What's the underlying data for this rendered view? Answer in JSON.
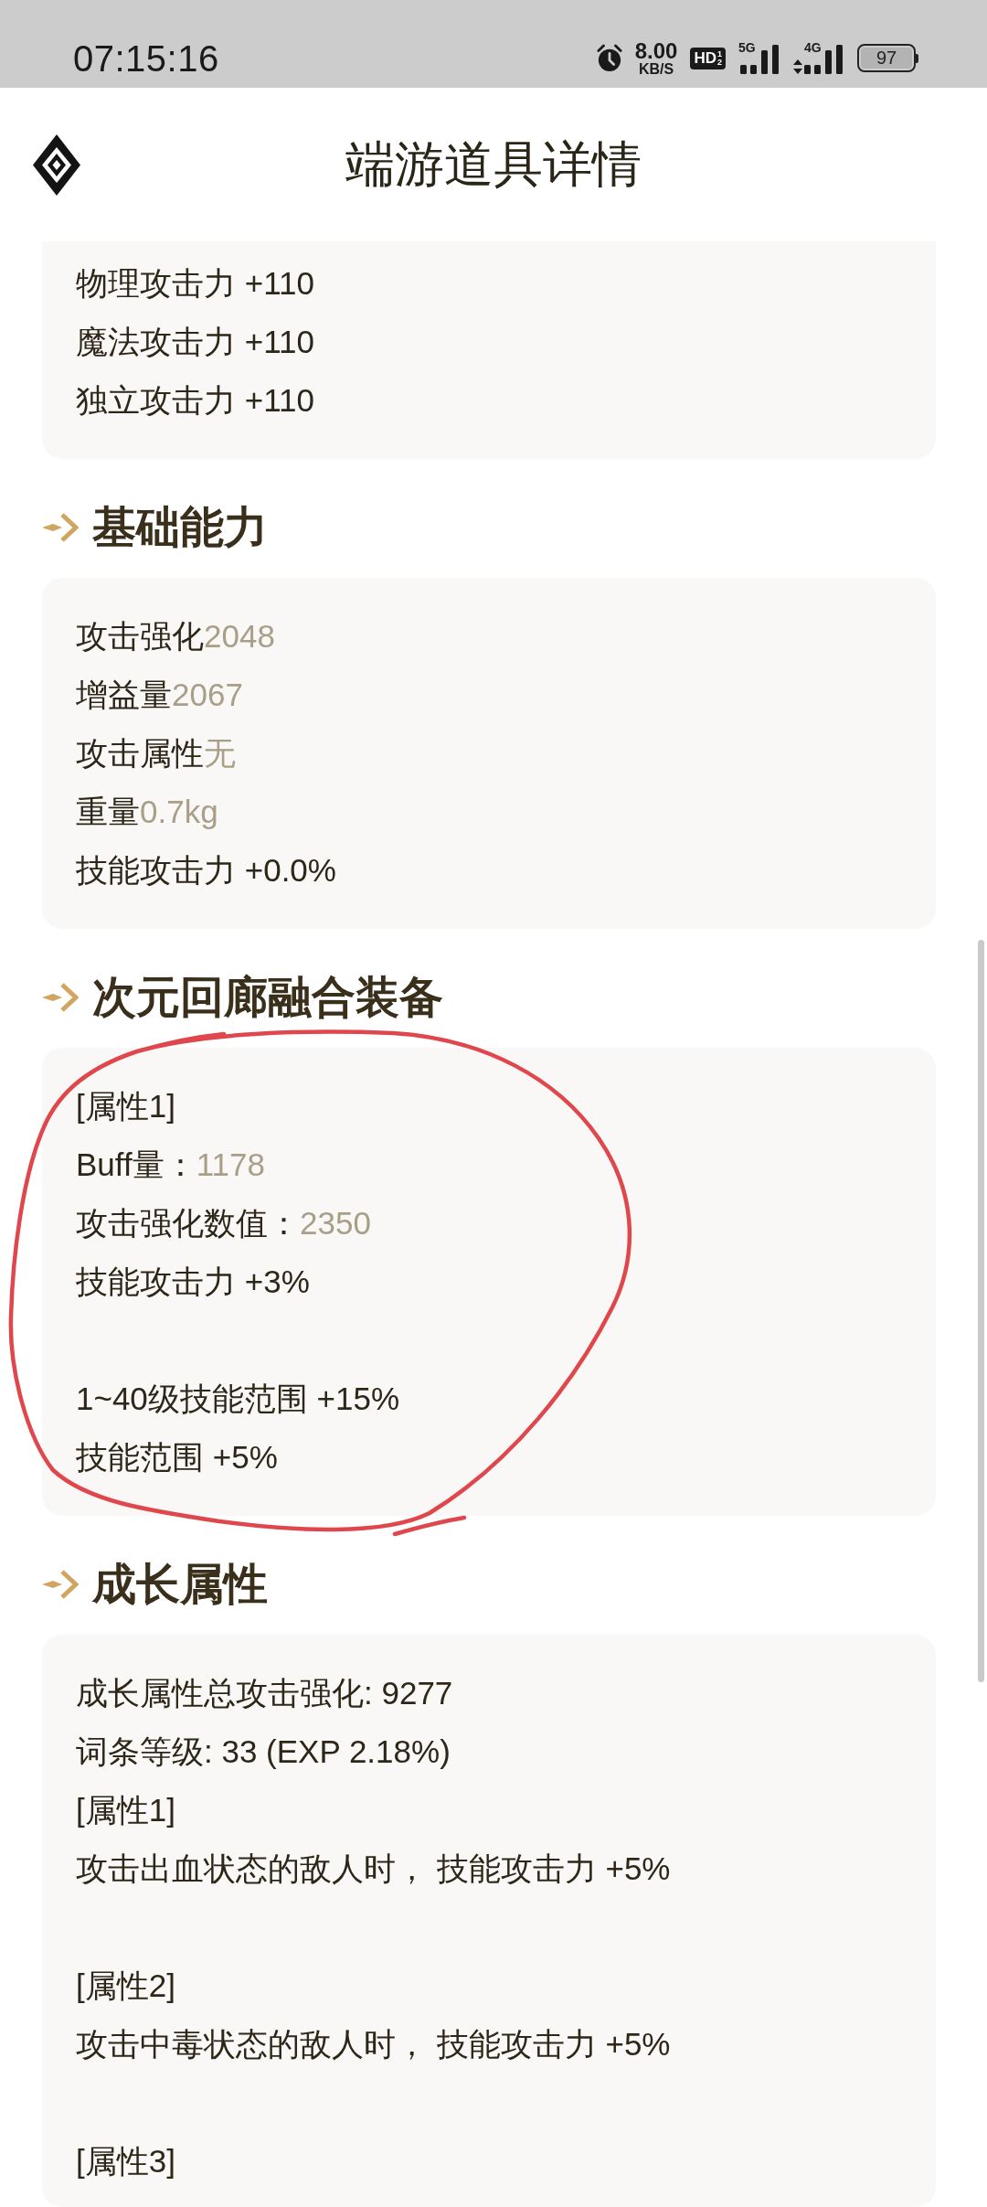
{
  "status_bar": {
    "time": "07:15:16",
    "net_speed": "8.00",
    "net_speed_unit": "KB/S",
    "hd_badge": {
      "text": "HD",
      "upper": "1",
      "lower": "2"
    },
    "signals": [
      {
        "network": "5G",
        "activity": false
      },
      {
        "network": "4G",
        "activity": true
      }
    ],
    "battery": "97"
  },
  "header": {
    "title": "端游道具详情"
  },
  "sections": [
    {
      "paragraphs": [
        {
          "lines": [
            {
              "kind": "plain",
              "text": "物理攻击力 +110"
            },
            {
              "kind": "plain",
              "text": "魔法攻击力 +110"
            },
            {
              "kind": "plain",
              "text": "独立攻击力 +110"
            }
          ]
        }
      ]
    },
    {
      "heading": "基础能力",
      "paragraphs": [
        {
          "lines": [
            {
              "kind": "pair",
              "label": "攻击强化",
              "value": "2048"
            },
            {
              "kind": "pair",
              "label": "增益量",
              "value": "2067"
            },
            {
              "kind": "pair",
              "label": "攻击属性",
              "value": "无"
            },
            {
              "kind": "pair",
              "label": "重量",
              "value": "0.7kg"
            },
            {
              "kind": "plain",
              "text": "技能攻击力 +0.0%"
            }
          ]
        }
      ]
    },
    {
      "heading": "次元回廊融合装备",
      "paragraphs": [
        {
          "lines": [
            {
              "kind": "plain",
              "text": "[属性1]"
            },
            {
              "kind": "pair",
              "label": "Buff量：",
              "value": "1178"
            },
            {
              "kind": "pair",
              "label": "攻击强化数值：",
              "value": "2350"
            },
            {
              "kind": "plain",
              "text": "技能攻击力 +3%"
            }
          ]
        },
        {
          "lines": [
            {
              "kind": "plain",
              "text": "1~40级技能范围 +15%"
            },
            {
              "kind": "plain",
              "text": "技能范围 +5%"
            }
          ]
        }
      ]
    },
    {
      "heading": "成长属性",
      "paragraphs": [
        {
          "lines": [
            {
              "kind": "plain",
              "text": "成长属性总攻击强化: 9277"
            },
            {
              "kind": "plain",
              "text": "词条等级: 33 (EXP 2.18%)"
            },
            {
              "kind": "plain",
              "text": "[属性1]"
            },
            {
              "kind": "plain",
              "text": "攻击出血状态的敌人时， 技能攻击力 +5%"
            }
          ]
        },
        {
          "lines": [
            {
              "kind": "plain",
              "text": "[属性2]"
            },
            {
              "kind": "plain",
              "text": "攻击中毒状态的敌人时， 技能攻击力 +5%"
            }
          ]
        },
        {
          "lines": [
            {
              "kind": "plain",
              "text": "[属性3]"
            }
          ]
        }
      ]
    }
  ]
}
